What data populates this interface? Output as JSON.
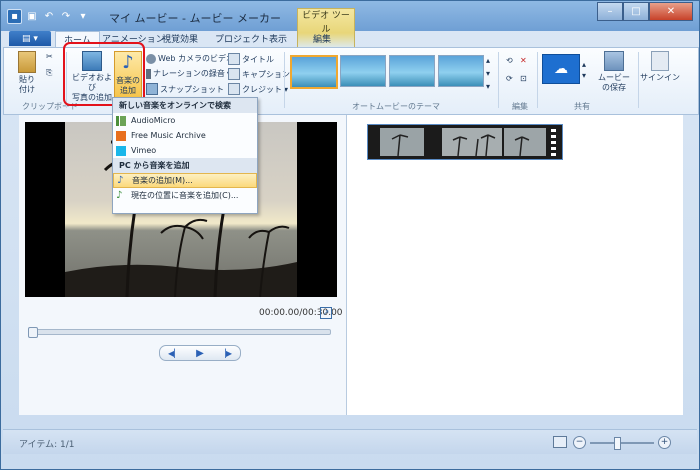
{
  "window": {
    "title": "マイ ムービー - ムービー メーカー",
    "context_tab": "ビデオ ツール",
    "controls": [
      "minimize",
      "maximize",
      "close"
    ]
  },
  "tabs": [
    {
      "label": "ホーム",
      "active": true
    },
    {
      "label": "アニメーション",
      "active": false
    },
    {
      "label": "視覚効果",
      "active": false
    },
    {
      "label": "プロジェクト",
      "active": false
    },
    {
      "label": "表示",
      "active": false
    },
    {
      "label": "編集",
      "active": false
    }
  ],
  "ribbon": {
    "clipboard": {
      "paste": "貼り\n付け",
      "group": "クリップボード"
    },
    "add": {
      "add_video": "ビデオおよび\n写真の追加",
      "add_music": "音楽の\n追加",
      "webcam": "Web カメラのビデオ",
      "narration": "ナレーションの録音",
      "snapshot": "スナップショット",
      "title": "タイトル",
      "caption": "キャプション",
      "credit": "クレジット"
    },
    "themes_group": "オートムービーのテーマ",
    "edit_group": "編集",
    "share_group": "共有",
    "save_movie": "ムービー\nの保存",
    "signin": "サインイン"
  },
  "music_menu": {
    "online_header": "新しい音楽をオンラインで検索",
    "online_items": [
      {
        "label": "AudioMicro",
        "icon": "audiomicro-icon"
      },
      {
        "label": "Free Music Archive",
        "icon": "fma-icon"
      },
      {
        "label": "Vimeo",
        "icon": "vimeo-icon"
      }
    ],
    "pc_header": "PC から音楽を追加",
    "pc_items": [
      {
        "label": "音楽の追加(M)...",
        "icon": "music-note-icon",
        "highlighted": true
      },
      {
        "label": "現在の位置に音楽を追加(C)...",
        "icon": "music-add-icon",
        "highlighted": false
      }
    ]
  },
  "preview": {
    "time": "00:00.00/00:30.00"
  },
  "status": {
    "items": "アイテム: 1/1"
  },
  "colors": {
    "accent": "#2b61b5",
    "highlight_box": "#e3121b",
    "menu_hover": "#fbd97c"
  }
}
